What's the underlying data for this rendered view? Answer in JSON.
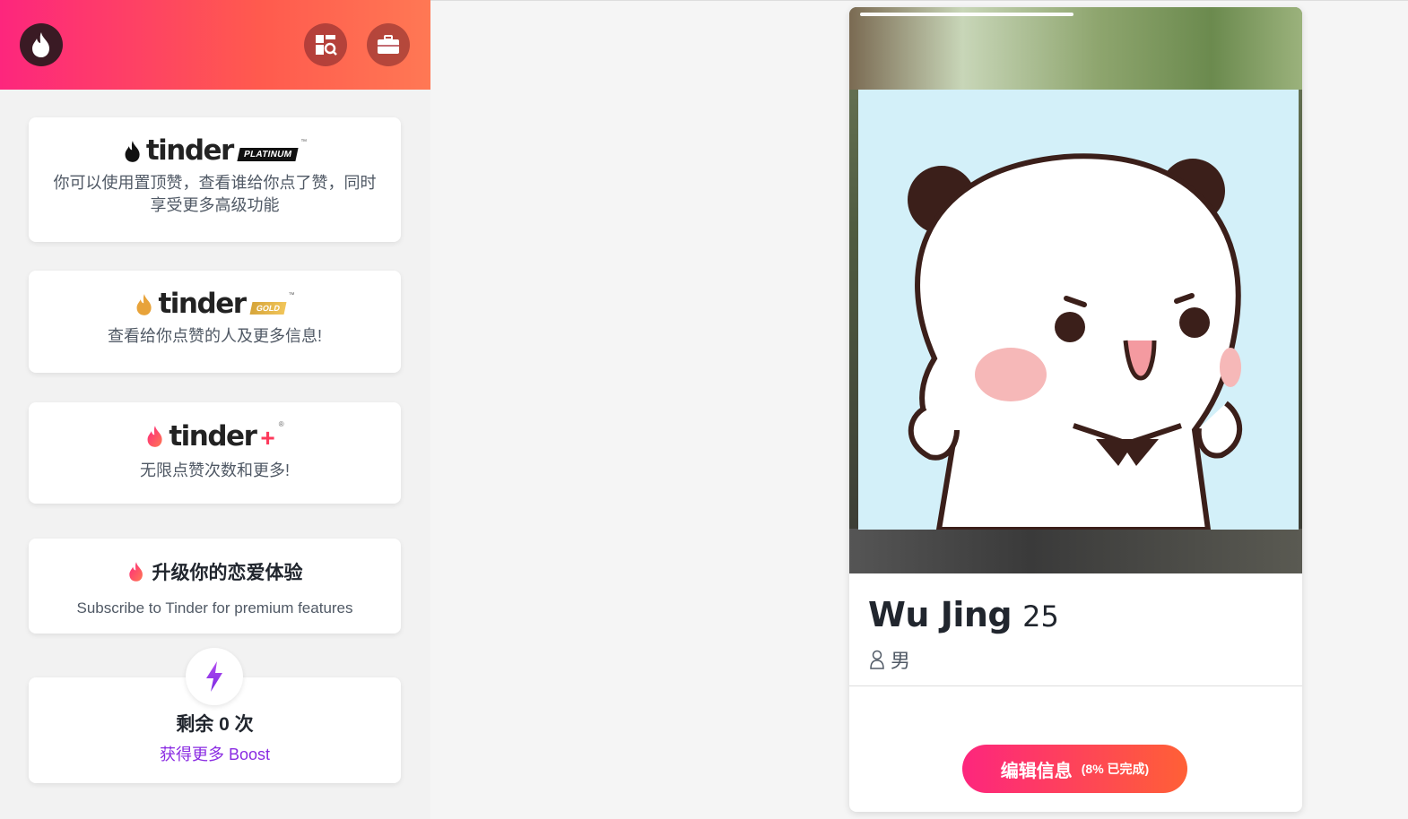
{
  "colors": {
    "brand_start": "#fd267d",
    "brand_end": "#ff7854",
    "boost_purple": "#8a2be2"
  },
  "header": {
    "icons": [
      "tinder-flame-icon",
      "explore-icon",
      "work-icon"
    ]
  },
  "cards": {
    "platinum": {
      "logo": "tinder",
      "badge": "PLATINUM",
      "tm": "™",
      "desc": "你可以使用置顶赞，查看谁给你点了赞，同时享受更多高级功能"
    },
    "gold": {
      "logo": "tinder",
      "badge": "GOLD",
      "tm": "™",
      "desc": "查看给你点赞的人及更多信息!"
    },
    "plus": {
      "logo": "tinder",
      "plus": "+",
      "reg": "®",
      "desc": "无限点赞次数和更多!"
    },
    "upgrade": {
      "title": "升级你的恋爱体验",
      "subtitle": "Subscribe to Tinder for premium features"
    },
    "boost": {
      "remaining": "剩余 0 次",
      "link": "获得更多 Boost"
    }
  },
  "profile": {
    "name": "Wu Jing",
    "age": "25",
    "gender": "男",
    "edit_label": "编辑信息",
    "edit_progress": "(8% 已完成)"
  }
}
